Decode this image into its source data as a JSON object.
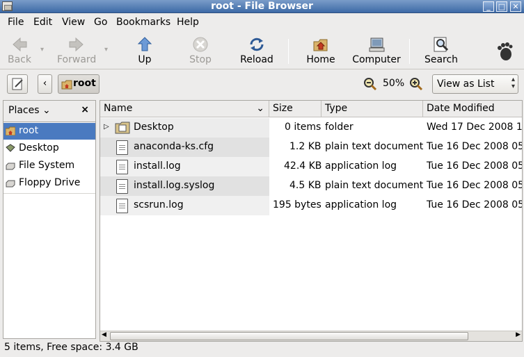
{
  "window": {
    "title": "root - File Browser",
    "controls": [
      "_",
      "□",
      "✕"
    ]
  },
  "menu": [
    "File",
    "Edit",
    "View",
    "Go",
    "Bookmarks",
    "Help"
  ],
  "toolbar": {
    "back": "Back",
    "forward": "Forward",
    "up": "Up",
    "stop": "Stop",
    "reload": "Reload",
    "home": "Home",
    "computer": "Computer",
    "search": "Search"
  },
  "location": {
    "path_button": "root",
    "zoom": "50%",
    "view_mode": "View as List"
  },
  "sidebar": {
    "header": "Places",
    "items": [
      {
        "label": "root",
        "icon": "home-folder-icon"
      },
      {
        "label": "Desktop",
        "icon": "desktop-icon"
      },
      {
        "label": "File System",
        "icon": "drive-icon"
      },
      {
        "label": "Floppy Drive",
        "icon": "floppy-icon"
      }
    ]
  },
  "columns": {
    "name": "Name",
    "size": "Size",
    "type": "Type",
    "date": "Date Modified"
  },
  "files": [
    {
      "name": "Desktop",
      "size": "0 items",
      "type": "folder",
      "date": "Wed 17 Dec 2008 11"
    },
    {
      "name": "anaconda-ks.cfg",
      "size": "1.2 KB",
      "type": "plain text document",
      "date": "Tue 16 Dec 2008 05:3"
    },
    {
      "name": "install.log",
      "size": "42.4 KB",
      "type": "application log",
      "date": "Tue 16 Dec 2008 05:3"
    },
    {
      "name": "install.log.syslog",
      "size": "4.5 KB",
      "type": "plain text document",
      "date": "Tue 16 Dec 2008 05:3"
    },
    {
      "name": "scsrun.log",
      "size": "195 bytes",
      "type": "application log",
      "date": "Tue 16 Dec 2008 05:3"
    }
  ],
  "status": "5 items, Free space: 3.4 GB"
}
